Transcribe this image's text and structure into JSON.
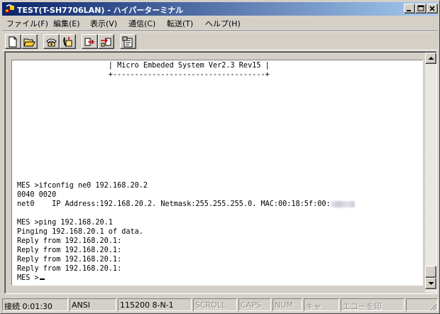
{
  "window": {
    "title": "TEST(T-SH7706LAN) - ハイパーターミナル"
  },
  "menu": {
    "items": [
      {
        "label": "ファイル(F)"
      },
      {
        "label": "編集(E)"
      },
      {
        "label": "表示(V)"
      },
      {
        "label": "通信(C)"
      },
      {
        "label": "転送(T)"
      },
      {
        "label": "ヘルプ(H)"
      }
    ]
  },
  "toolbar": {
    "buttons": [
      {
        "icon": "new-document-icon"
      },
      {
        "icon": "open-folder-icon"
      },
      {
        "icon": "phone-call-icon"
      },
      {
        "icon": "phone-disconnect-icon"
      },
      {
        "icon": "send-file-icon"
      },
      {
        "icon": "receive-file-icon"
      },
      {
        "icon": "properties-icon"
      }
    ]
  },
  "terminal": {
    "lines": [
      "                     | Micro Embeded System Ver2.3 Rev15 |",
      "                     +-----------------------------------+",
      "",
      "",
      "",
      "",
      "",
      "",
      "",
      "",
      "",
      "",
      "",
      "MES >ifconfig ne0 192.168.20.2",
      "0040 0020",
      "net0    IP Address:192.168.20.2. Netmask:255.255.255.0. MAC:00:18:5f:00:",
      "",
      "MES >ping 192.168.20.1",
      "Pinging 192.168.20.1 of data.",
      "Reply from 192.168.20.1:",
      "Reply from 192.168.20.1:",
      "Reply from 192.168.20.1:",
      "Reply from 192.168.20.1:",
      "MES >"
    ]
  },
  "statusbar": {
    "connected": "接続 0:01:30",
    "emulation": "ANSI",
    "settings": "115200 8-N-1",
    "scroll": "SCROLL",
    "caps": "CAPS",
    "num": "NUM",
    "capture": "キャ",
    "print_echo": "エコーを印"
  },
  "colors": {
    "title_start": "#0a246a",
    "title_end": "#a6caf0",
    "face": "#d4d0c8"
  }
}
